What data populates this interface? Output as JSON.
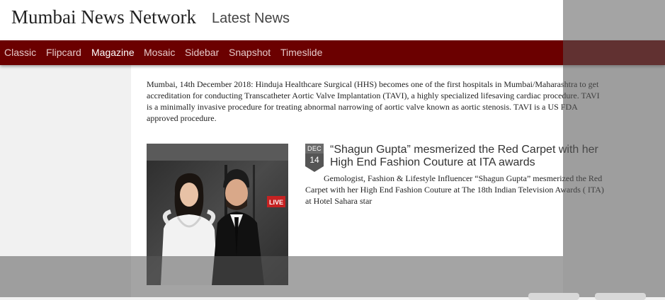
{
  "header": {
    "site_title": "Mumbai News Network",
    "subtitle": "Latest News"
  },
  "nav": {
    "items": [
      {
        "label": "Classic",
        "active": false
      },
      {
        "label": "Flipcard",
        "active": false
      },
      {
        "label": "Magazine",
        "active": true
      },
      {
        "label": "Mosaic",
        "active": false
      },
      {
        "label": "Sidebar",
        "active": false
      },
      {
        "label": "Snapshot",
        "active": false
      },
      {
        "label": "Timeslide",
        "active": false
      }
    ]
  },
  "intro_article": {
    "excerpt": "Mumbai, 14th December 2018: Hinduja Healthcare Surgical (HHS) becomes one of the first hospitals in Mumbai/Maharashtra to get accreditation for conducting Transcatheter Aortic Valve Implantation (TAVI), a highly specialized lifesaving cardiac procedure. TAVI is a minimally invasive procedure for treating abnormal narrowing of aortic valve known as aortic stenosis. TAVI is a US FDA approved procedure."
  },
  "featured_article": {
    "date_month": "DEC",
    "date_day": "14",
    "title": "“Shagun Gupta” mesmerized the Red Carpet with her High End Fashion Couture at ITA awards",
    "excerpt": "Gemologist, Fashion & Lifestyle Influencer “Shagun Gupta” mesmerized the Red Carpet with her High End Fashion Couture at The 18th Indian Television Awards ( ITA) at Hotel Sahara star",
    "photo_badge": "LIVE"
  },
  "colors": {
    "nav_bg": "#6b0000",
    "nav_text": "#e6c9c9",
    "nav_active": "#ffffff"
  }
}
